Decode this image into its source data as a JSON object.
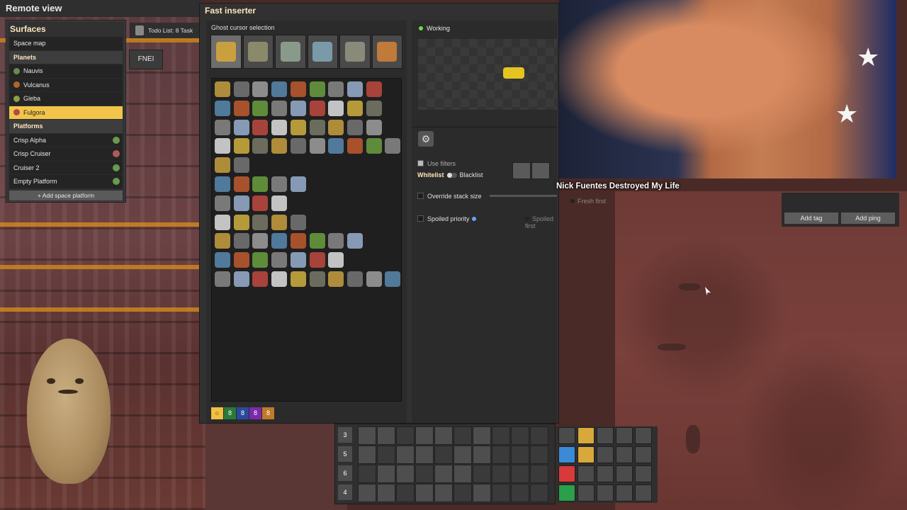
{
  "remote_view": {
    "title": "Remote view"
  },
  "surfaces": {
    "title": "Surfaces",
    "space_map": "Space map",
    "planets_header": "Planets",
    "planets": [
      {
        "name": "Nauvis",
        "color": "#6c8a4a"
      },
      {
        "name": "Vulcanus",
        "color": "#b3642e"
      },
      {
        "name": "Gleba",
        "color": "#8aa04a"
      },
      {
        "name": "Fulgora",
        "color": "#b04a4a",
        "selected": true
      }
    ],
    "platforms_header": "Platforms",
    "platforms": [
      {
        "name": "Crisp Alpha",
        "status": "green"
      },
      {
        "name": "Crisp Cruiser",
        "status": "red"
      },
      {
        "name": "Cruiser 2",
        "status": "green"
      },
      {
        "name": "Empty Platform",
        "status": "green"
      }
    ],
    "add_platform": "+ Add space platform"
  },
  "todo": {
    "label": "Todo List: 8 Task"
  },
  "fnei": {
    "label": "FNEI"
  },
  "inserter": {
    "title": "Fast inserter",
    "ghost_title": "Ghost cursor selection",
    "status": "Working",
    "use_filters": "Use filters",
    "whitelist": "Whitelist",
    "blacklist": "Blacklist",
    "override_stack": "Override stack size",
    "spoiled_priority": "Spoiled priority",
    "spoiled_first": "Spoiled first",
    "fresh_first": "Fresh first",
    "bottom_tabs": [
      "○",
      "8",
      "8",
      "8",
      "8"
    ]
  },
  "stream": {
    "caption": "Nick Fuentes Destroyed My Life"
  },
  "tags": {
    "add_tag": "Add tag",
    "add_ping": "Add ping"
  },
  "hotbar": {
    "rows": [
      "3",
      "5",
      "6",
      "4"
    ]
  }
}
